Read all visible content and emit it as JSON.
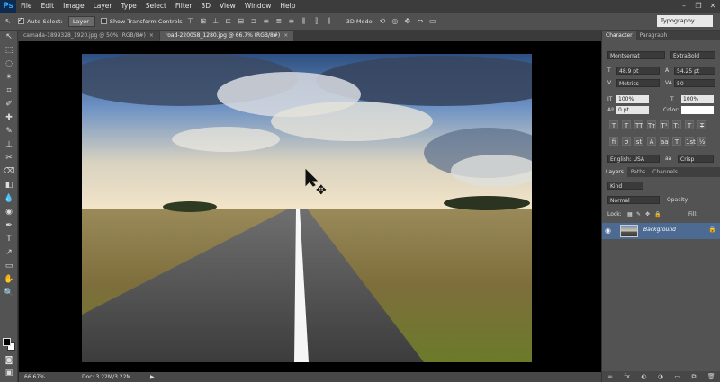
{
  "app": {
    "logo": "Ps"
  },
  "menu": [
    "File",
    "Edit",
    "Image",
    "Layer",
    "Type",
    "Select",
    "Filter",
    "3D",
    "View",
    "Window",
    "Help"
  ],
  "window_controls": [
    "–",
    "❐",
    "✕"
  ],
  "options": {
    "auto_select_label": "Auto-Select:",
    "auto_select_value": "Layer",
    "show_transform_label": "Show Transform Controls",
    "mode_3d_label": "3D Mode:",
    "workspace": "Typography"
  },
  "tabs": [
    {
      "label": "camada-1899328_1920.jpg @ 50% (RGB/8#)",
      "close": "×"
    },
    {
      "label": "road-220058_1280.jpg @ 66.7% (RGB/8#)",
      "close": "×"
    }
  ],
  "status": {
    "zoom": "66.67%",
    "doc": "Doc: 3.22M/3.22M",
    "arrow": "▶"
  },
  "character": {
    "tabs": [
      "Character",
      "Paragraph"
    ],
    "font_family": "Montserrat",
    "font_style": "ExtraBold",
    "font_size": "48.9 pt",
    "leading": "54.25 pt",
    "kerning": "Metrics",
    "tracking": "50",
    "vertical_scale": "100%",
    "horizontal_scale": "100%",
    "baseline_shift": "0 pt",
    "color_label": "Color:",
    "language": "English: USA",
    "antialias": "Crisp",
    "style_buttons": [
      "T",
      "T",
      "TT",
      "Tт",
      "T¹",
      "T₁",
      "T",
      "T"
    ],
    "opentype_buttons": [
      "fi",
      "ơ",
      "st",
      "A",
      "aa",
      "T",
      "1st",
      "½"
    ]
  },
  "layers": {
    "tabs": [
      "Layers",
      "Paths",
      "Channels"
    ],
    "kind_label": "Kind",
    "blend_mode": "Normal",
    "opacity_label": "Opacity:",
    "lock_label": "Lock:",
    "fill_label": "Fill:",
    "layer_name": "Background",
    "bottom_icons": [
      "∞",
      "fx",
      "◐",
      "◑",
      "▭",
      "⧉",
      "🗑"
    ]
  },
  "tools": [
    "↖",
    "⬚",
    "◌",
    "✴",
    "⌗",
    "✐",
    "✚",
    "✎",
    "⊥",
    "✂",
    "⌫",
    "◧",
    "💧",
    "◉",
    "✒",
    "T",
    "↗",
    "▭",
    "✋",
    "🔍"
  ]
}
